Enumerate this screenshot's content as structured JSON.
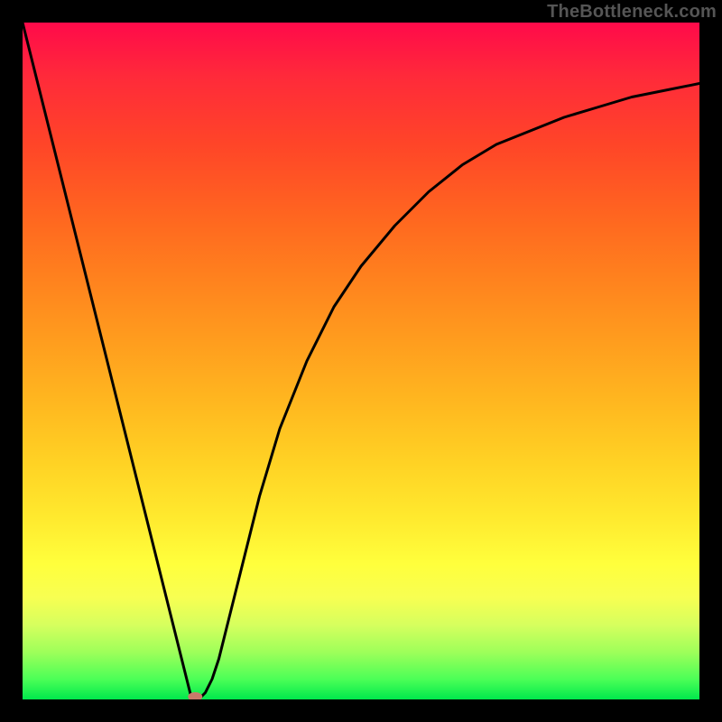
{
  "watermark": "TheBottleneck.com",
  "chart_data": {
    "type": "line",
    "title": "",
    "xlabel": "",
    "ylabel": "",
    "xlim": [
      0,
      100
    ],
    "ylim": [
      0,
      100
    ],
    "grid": false,
    "series": [
      {
        "name": "bottleneck-curve",
        "x": [
          0,
          2,
          4,
          6,
          8,
          10,
          12,
          14,
          16,
          18,
          20,
          22,
          24,
          25,
          26,
          27,
          28,
          29,
          30,
          32,
          35,
          38,
          42,
          46,
          50,
          55,
          60,
          65,
          70,
          75,
          80,
          85,
          90,
          95,
          100
        ],
        "y": [
          100,
          92,
          84,
          76,
          68,
          60,
          52,
          44,
          36,
          28,
          20,
          12,
          4,
          0,
          0,
          1,
          3,
          6,
          10,
          18,
          30,
          40,
          50,
          58,
          64,
          70,
          75,
          79,
          82,
          84,
          86,
          87.5,
          89,
          90,
          91
        ]
      }
    ],
    "marker": {
      "x": 25.5,
      "y": 0,
      "color": "#c97a6a"
    },
    "colors": {
      "curve": "#000000",
      "background_top": "#ff0a4a",
      "background_bottom": "#00e84c",
      "frame": "#000000"
    }
  }
}
